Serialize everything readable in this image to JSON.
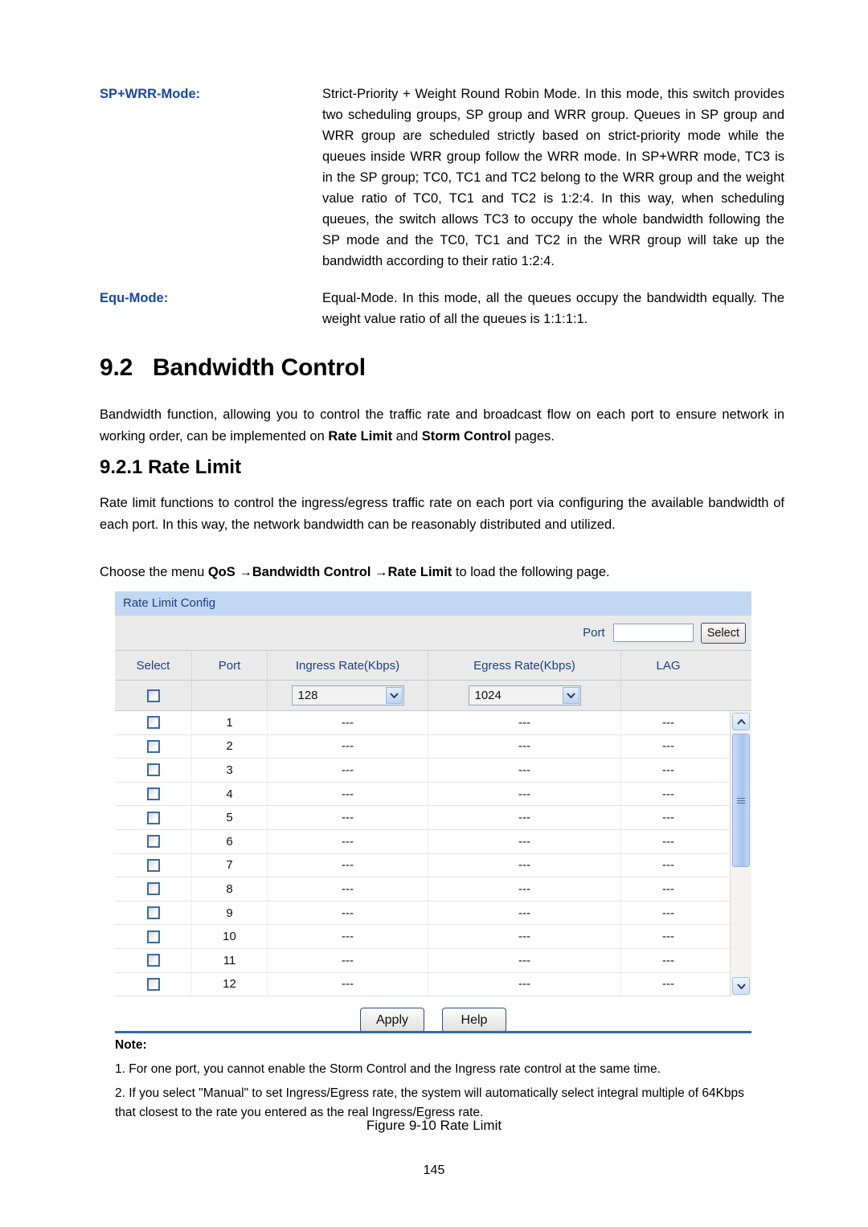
{
  "definitions": [
    {
      "term": "SP+WRR-Mode:",
      "description": "Strict-Priority + Weight Round Robin Mode. In this mode, this switch provides two scheduling groups, SP group and WRR group. Queues in SP group and WRR group are scheduled strictly based on strict-priority mode while the queues inside WRR group follow the WRR mode. In SP+WRR mode, TC3 is in the SP group; TC0, TC1 and TC2 belong to the WRR group and the weight value ratio of TC0, TC1 and TC2 is 1:2:4. In this way, when scheduling queues, the switch allows TC3 to occupy the whole bandwidth following the SP mode and the TC0, TC1 and TC2 in the WRR group will take up the bandwidth according to their ratio 1:2:4."
    },
    {
      "term": "Equ-Mode:",
      "description": "Equal-Mode. In this mode, all the queues occupy the bandwidth equally. The weight value ratio of all the queues is 1:1:1:1."
    }
  ],
  "section": {
    "number": "9.2",
    "title": "Bandwidth Control",
    "intro_pre": "Bandwidth function, allowing you to control the traffic rate and broadcast flow on each port to ensure network in working order, can be implemented on ",
    "intro_bold1": "Rate Limit",
    "intro_mid": " and ",
    "intro_bold2": "Storm Control",
    "intro_post": " pages."
  },
  "subsection": {
    "number": "9.2.1",
    "title": "Rate Limit",
    "paragraph": "Rate limit functions to control the ingress/egress traffic rate on each port via configuring the available bandwidth of each port. In this way, the network bandwidth can be reasonably distributed and utilized.",
    "choose_pre": "Choose the menu ",
    "choose_b1": "QoS →",
    "choose_b2": "Bandwidth Control →",
    "choose_b3": "Rate Limit",
    "choose_post": " to load the following page."
  },
  "screenshot": {
    "panel_title": "Rate Limit Config",
    "toolbar": {
      "port_label": "Port",
      "port_value": "",
      "port_placeholder": "",
      "select_button": "Select"
    },
    "columns": [
      "Select",
      "Port",
      "Ingress Rate(Kbps)",
      "Egress Rate(Kbps)",
      "LAG"
    ],
    "config_row": {
      "checkbox_checked": false,
      "port": "",
      "ingress_rate": "128",
      "egress_rate": "1024",
      "lag": ""
    },
    "rows": [
      {
        "port": "1",
        "ingress": "---",
        "egress": "---",
        "lag": "---"
      },
      {
        "port": "2",
        "ingress": "---",
        "egress": "---",
        "lag": "---"
      },
      {
        "port": "3",
        "ingress": "---",
        "egress": "---",
        "lag": "---"
      },
      {
        "port": "4",
        "ingress": "---",
        "egress": "---",
        "lag": "---"
      },
      {
        "port": "5",
        "ingress": "---",
        "egress": "---",
        "lag": "---"
      },
      {
        "port": "6",
        "ingress": "---",
        "egress": "---",
        "lag": "---"
      },
      {
        "port": "7",
        "ingress": "---",
        "egress": "---",
        "lag": "---"
      },
      {
        "port": "8",
        "ingress": "---",
        "egress": "---",
        "lag": "---"
      },
      {
        "port": "9",
        "ingress": "---",
        "egress": "---",
        "lag": "---"
      },
      {
        "port": "10",
        "ingress": "---",
        "egress": "---",
        "lag": "---"
      },
      {
        "port": "11",
        "ingress": "---",
        "egress": "---",
        "lag": "---"
      },
      {
        "port": "12",
        "ingress": "---",
        "egress": "---",
        "lag": "---"
      }
    ],
    "buttons": {
      "apply": "Apply",
      "help": "Help"
    },
    "note": {
      "title": "Note:",
      "items": [
        "1. For one port, you cannot enable the Storm Control and the Ingress rate control at the same time.",
        "2. If you select \"Manual\" to set Ingress/Egress rate, the system will automatically select integral multiple of 64Kbps that closest to the rate you entered as the real Ingress/Egress rate."
      ]
    },
    "colors": {
      "panel_header_bg": "#c2d7f2",
      "panel_header_text": "#1b3f87",
      "toolbar_bg": "#eaeaea",
      "accent_blue": "#17479e",
      "note_rule": "#2b6ca3"
    }
  },
  "figure_caption": "Figure 9-10 Rate Limit",
  "page_number": "145"
}
